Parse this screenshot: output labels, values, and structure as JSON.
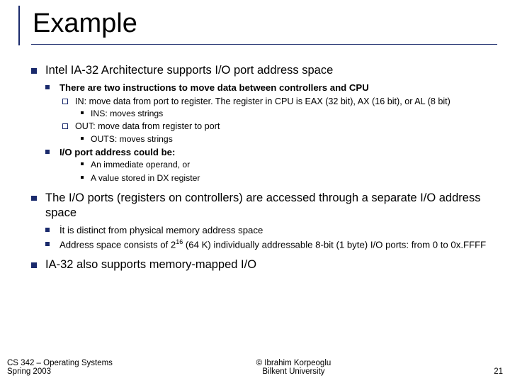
{
  "title": "Example",
  "bullets": {
    "p1": "Intel IA-32 Architecture supports I/O port address space",
    "p1_1": "There are two instructions to move data between controllers and CPU",
    "p1_1_1": "IN: move data from port to register. The register in CPU is EAX (32 bit), AX (16 bit), or AL (8 bit)",
    "p1_1_1_1": "INS: moves strings",
    "p1_1_2": "OUT: move data from register to port",
    "p1_1_2_1": "OUTS: moves strings",
    "p1_2": "I/O port address could be:",
    "p1_2_1": "An immediate operand, or",
    "p1_2_2": "A value stored in DX register",
    "p2": "The I/O ports (registers on controllers) are accessed through a separate I/O address space",
    "p2_1": "İt is distinct from physical memory address space",
    "p2_2_a": "Address space consists of 2",
    "p2_2_sup": "16",
    "p2_2_b": " (64 K) individually addressable 8-bit (1 byte)  I/O ports: from 0 to 0x.FFFF",
    "p3": "IA-32 also supports memory-mapped I/O"
  },
  "footer": {
    "left_line1": "CS 342 – Operating Systems",
    "left_line2": "Spring 2003",
    "center_line1": "© Ibrahim Korpeoglu",
    "center_line2": "Bilkent University",
    "right": "21"
  }
}
